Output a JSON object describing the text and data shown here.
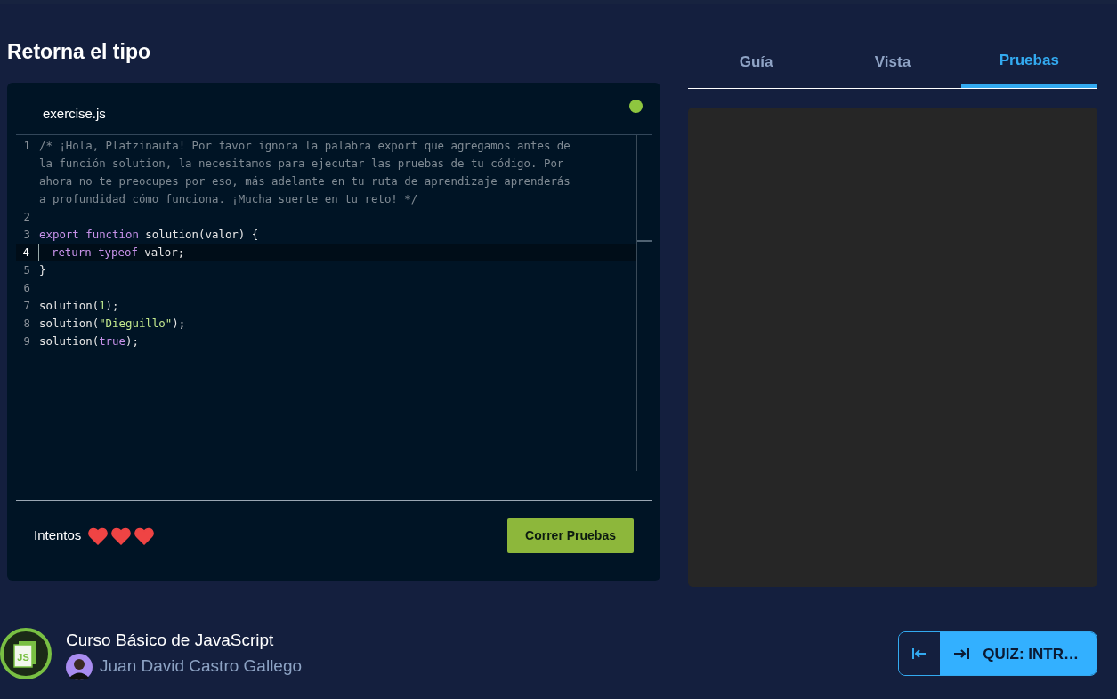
{
  "title": "Retorna el tipo",
  "editor": {
    "filename": "exercise.js",
    "lines": [
      {
        "number": "1",
        "active": false,
        "tokens": [
          {
            "kind": "comment",
            "text": "/* ¡Hola, Platzinauta! Por favor ignora la palabra export que agregamos antes de la función solution, la necesitamos para ejecutar las pruebas de tu código. Por ahora no te preocupes por eso, más adelante en tu ruta de aprendizaje aprenderás a profundidad cómo funciona. ¡Mucha suerte en tu reto! */"
          }
        ]
      },
      {
        "number": "2",
        "active": false
      },
      {
        "number": "3",
        "active": false,
        "tokens": [
          {
            "kind": "keyword",
            "text": "export function"
          },
          {
            "kind": "plain",
            "text": " solution(valor) {"
          }
        ]
      },
      {
        "number": "4",
        "active": true,
        "tokens": [
          {
            "kind": "keyword",
            "text": "  return typeof"
          },
          {
            "kind": "plain",
            "text": " valor;"
          }
        ]
      },
      {
        "number": "5",
        "active": false,
        "tokens": [
          {
            "kind": "plain",
            "text": "}"
          }
        ]
      },
      {
        "number": "6",
        "active": false
      },
      {
        "number": "7",
        "active": false,
        "tokens": [
          {
            "kind": "plain",
            "text": "solution("
          },
          {
            "kind": "number",
            "text": "1"
          },
          {
            "kind": "plain",
            "text": ");"
          }
        ]
      },
      {
        "number": "8",
        "active": false,
        "tokens": [
          {
            "kind": "plain",
            "text": "solution("
          },
          {
            "kind": "string",
            "text": "\"Dieguillo\""
          },
          {
            "kind": "plain",
            "text": ");"
          }
        ]
      },
      {
        "number": "9",
        "active": false,
        "tokens": [
          {
            "kind": "plain",
            "text": "solution("
          },
          {
            "kind": "keyword",
            "text": "true"
          },
          {
            "kind": "plain",
            "text": ");"
          }
        ]
      }
    ]
  },
  "attempts": {
    "label": "Intentos",
    "hearts": [
      {
        "filled": true
      },
      {
        "filled": true
      },
      {
        "filled": true
      }
    ]
  },
  "run_button": "Correr Pruebas",
  "tabs": [
    {
      "label": "Guía",
      "selected": false
    },
    {
      "label": "Vista",
      "selected": false
    },
    {
      "label": "Pruebas",
      "selected": true
    }
  ],
  "course": {
    "badge": "JS",
    "title": "Curso Básico de JavaScript",
    "teacher": "Juan David Castro Gallego"
  },
  "next_button": "QUIZ: INTR…"
}
